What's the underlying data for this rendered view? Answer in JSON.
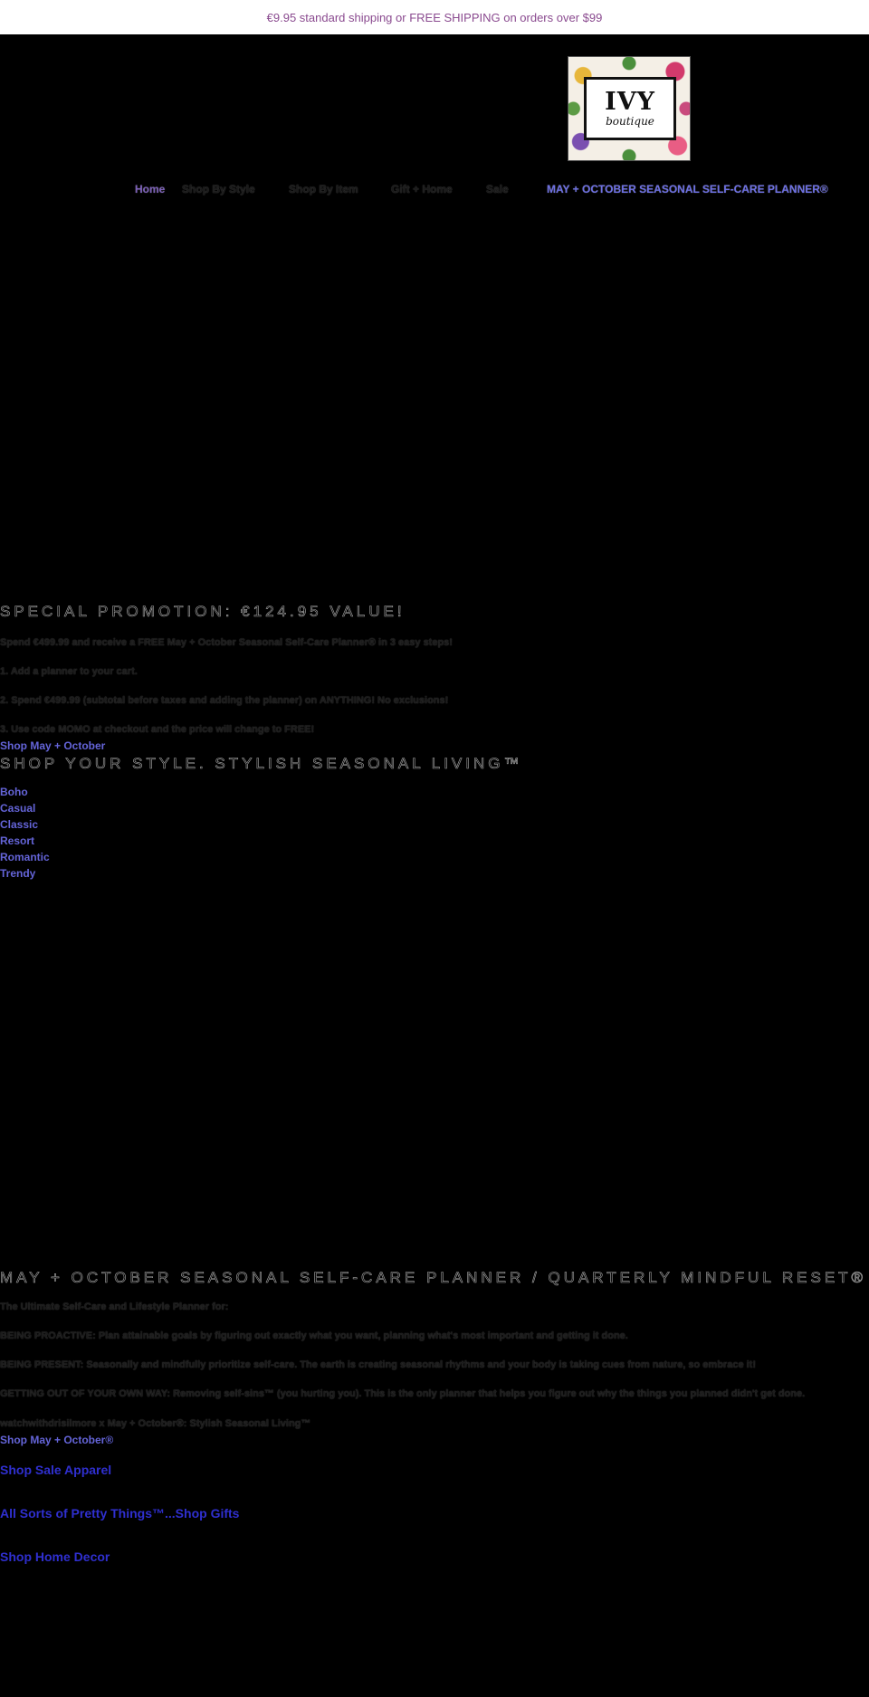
{
  "announcement": "€9.95 standard shipping or FREE SHIPPING on orders over $99",
  "logo": {
    "word": "IVY",
    "sub": "boutique"
  },
  "nav": {
    "home": "Home",
    "shop_by_style": "Shop By Style",
    "shop_by_item": "Shop By Item",
    "gift_home": "Gift + Home",
    "sale": "Sale",
    "planner": "MAY + OCTOBER SEASONAL SELF-CARE PLANNER®"
  },
  "promo": {
    "title": "SPECIAL PROMOTION: €124.95 VALUE!",
    "intro": "Spend €499.99 and receive a FREE May + October Seasonal Self-Care Planner® in 3 easy steps!",
    "step1": "1. Add a planner to your cart.",
    "step2": "2. Spend €499.99 (subtotal before taxes and adding the planner) on ANYTHING! No exclusions!",
    "step3": "3. Use code MOMO at checkout and the price will change to FREE!",
    "link": "Shop May + October"
  },
  "styles": {
    "title": "SHOP YOUR STYLE. STYLISH SEASONAL LIVING™",
    "items": [
      "Boho",
      "Casual",
      "Classic",
      "Resort",
      "Romantic",
      "Trendy"
    ]
  },
  "planner_section": {
    "title": "MAY + OCTOBER SEASONAL SELF-CARE PLANNER / QUARTERLY MINDFUL RESET®",
    "subtitle": "The Ultimate Self-Care and Lifestyle Planner for:",
    "line1": "BEING PROACTIVE: Plan attainable goals by figuring out exactly what you want, planning what's most important and getting it done.",
    "line2": "BEING PRESENT: Seasonally and mindfully prioritize self-care. The earth is creating seasonal rhythms and your body is taking cues from nature, so embrace it!",
    "line3": "GETTING OUT OF YOUR OWN WAY: Removing self-sins™ (you hurting you). This is the only planner that helps you figure out why the things you planned didn't get done.",
    "line4": "watchwithdrisilmore x May + October®: Stylish Seasonal Living™",
    "link": "Shop May + October®"
  },
  "footer_links": {
    "sale_apparel": "Shop Sale Apparel",
    "gifts": "All Sorts of Pretty Things™...Shop Gifts",
    "home_decor": "Shop Home Decor"
  }
}
